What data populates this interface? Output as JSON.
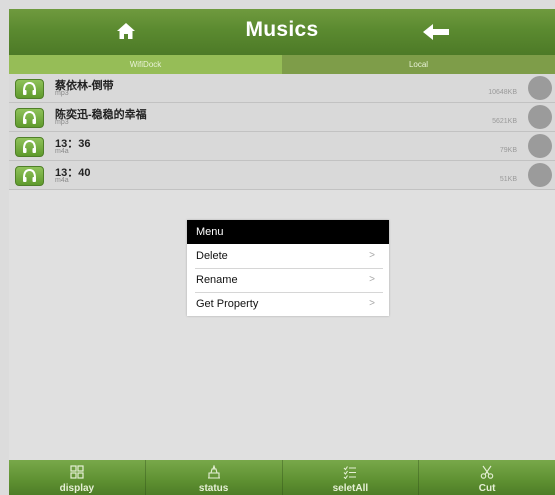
{
  "header": {
    "title": "Musics",
    "home_icon": "home-icon",
    "back_icon": "back-arrow-icon"
  },
  "tabs": [
    {
      "label": "WifiDock",
      "active": true
    },
    {
      "label": "Local",
      "active": false
    }
  ],
  "files": [
    {
      "name": "蔡依林-倒带",
      "type": "mp3",
      "size": "10648KB"
    },
    {
      "name": "陈奕迅-稳稳的幸福",
      "type": "mp3",
      "size": "5621KB"
    },
    {
      "name": "13：36",
      "type": "m4a",
      "size": "79KB"
    },
    {
      "name": "13：40",
      "type": "m4a",
      "size": "51KB"
    }
  ],
  "menu": {
    "title": "Menu",
    "items": [
      {
        "label": "Delete",
        "chevron": ">"
      },
      {
        "label": "Rename",
        "chevron": ">"
      },
      {
        "label": "Get Property",
        "chevron": ">"
      }
    ]
  },
  "footer": [
    {
      "label": "display",
      "icon": "grid-icon"
    },
    {
      "label": "status",
      "icon": "status-icon"
    },
    {
      "label": "seletAll",
      "icon": "select-all-icon"
    },
    {
      "label": "Cut",
      "icon": "scissors-icon"
    }
  ],
  "colors": {
    "header_green": "#5b8a30",
    "tab_active": "#96bd57",
    "row_bg": "#d9d9d9",
    "menu_title_bg": "#000000"
  }
}
